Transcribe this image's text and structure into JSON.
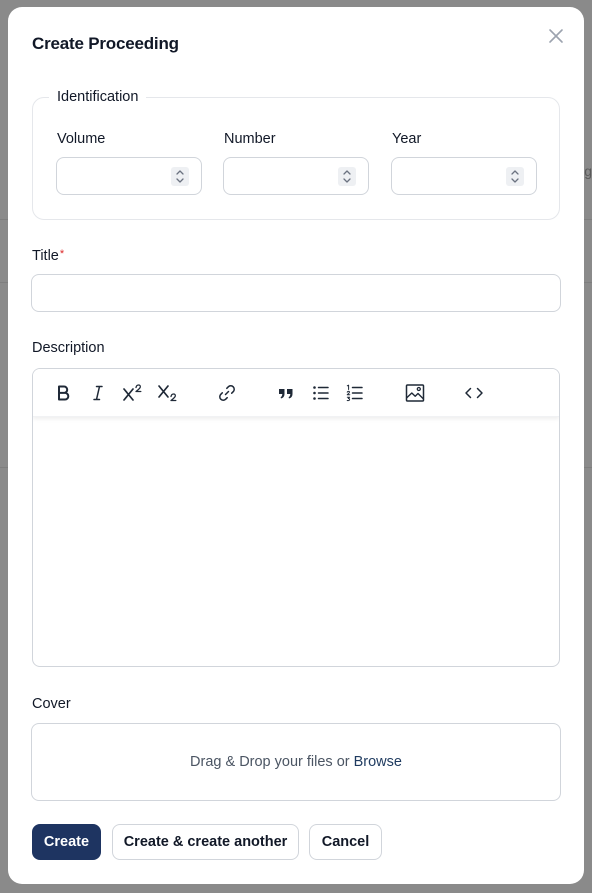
{
  "modal": {
    "title": "Create Proceeding",
    "close_icon": "x-icon"
  },
  "identification": {
    "legend": "Identification",
    "fields": [
      {
        "label": "Volume",
        "value": ""
      },
      {
        "label": "Number",
        "value": ""
      },
      {
        "label": "Year",
        "value": ""
      }
    ]
  },
  "title_field": {
    "label": "Title",
    "required_mark": "*",
    "value": ""
  },
  "description": {
    "label": "Description",
    "toolbar": [
      "bold-icon",
      "italic-icon",
      "superscript-icon",
      "subscript-icon",
      "link-icon",
      "quote-icon",
      "bullet-list-icon",
      "numbered-list-icon",
      "image-icon",
      "code-icon"
    ],
    "content": ""
  },
  "cover": {
    "label": "Cover",
    "dropzone_text": "Drag & Drop your files or",
    "browse_label": "Browse"
  },
  "actions": {
    "create": "Create",
    "create_another": "Create & create another",
    "cancel": "Cancel"
  },
  "colors": {
    "primary": "#1e3461",
    "required": "#dc2626",
    "border": "#d1d5db"
  }
}
